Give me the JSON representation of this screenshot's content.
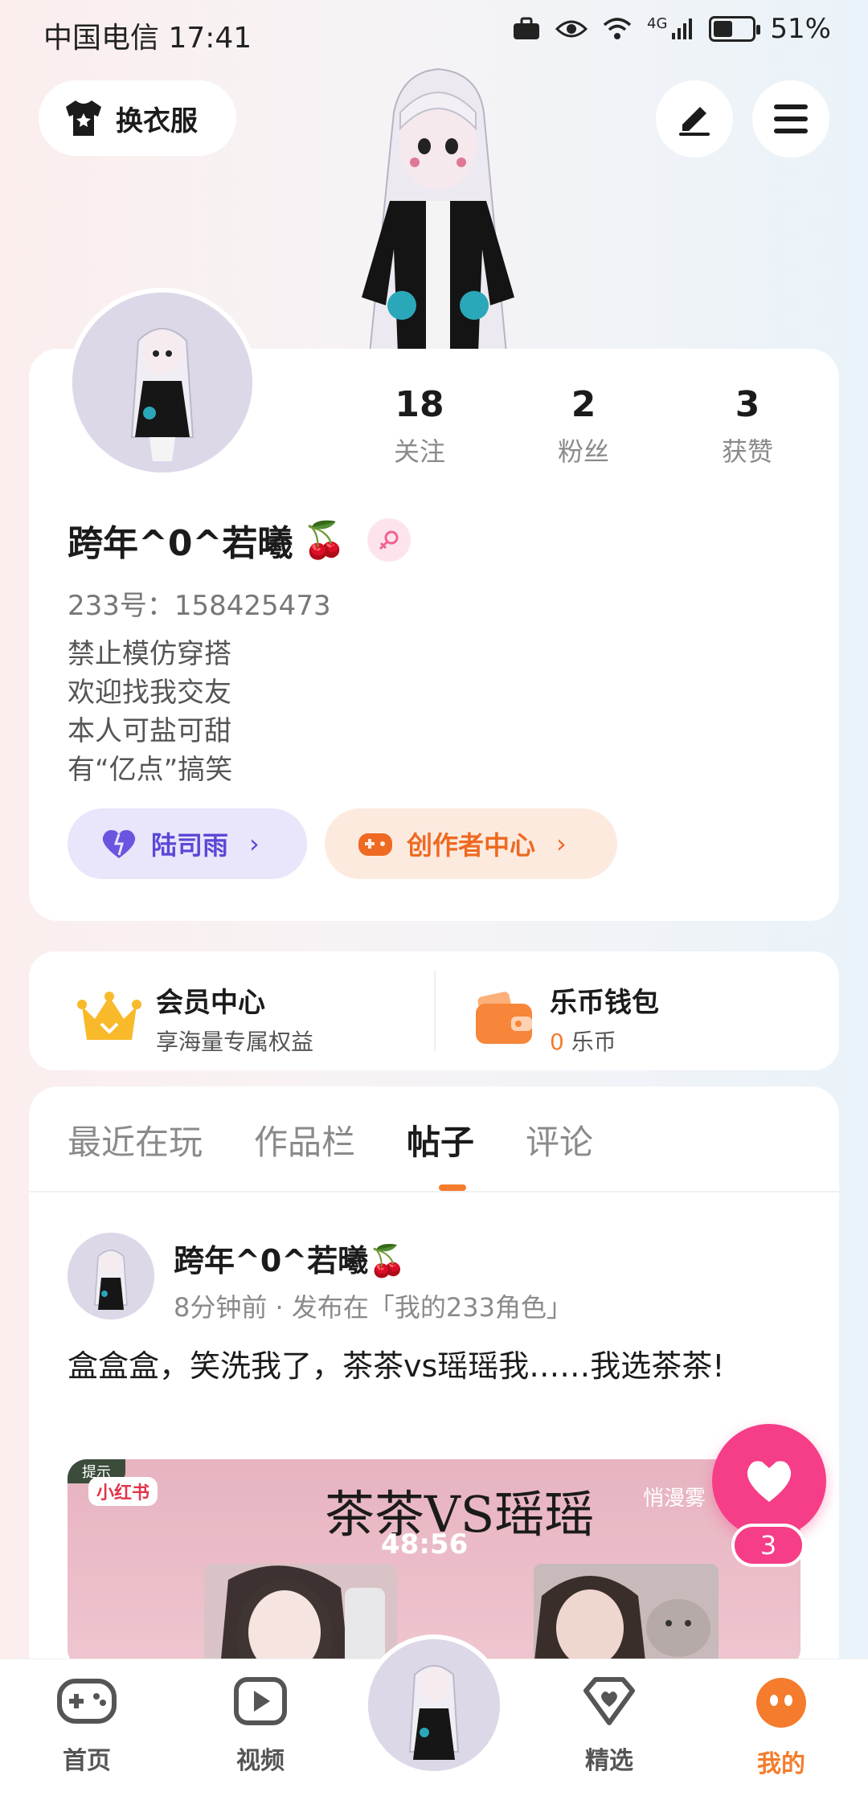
{
  "status": {
    "carrier_time": "中国电信 17:41",
    "network": "4G",
    "battery": "51%",
    "battery_level": 0.51
  },
  "header": {
    "outfit_label": "换衣服",
    "icons": [
      "shirt-icon",
      "edit-icon",
      "menu-icon"
    ]
  },
  "profile": {
    "name": "跨年^0^若曦",
    "name_emoji": "🍒",
    "uid": "233号：158425473",
    "stats": [
      {
        "num": "18",
        "label": "关注"
      },
      {
        "num": "2",
        "label": "粉丝"
      },
      {
        "num": "3",
        "label": "获赞"
      }
    ],
    "bio": [
      "禁止模仿穿搭",
      "欢迎找我交友",
      "本人可盐可甜",
      "有“亿点”搞笑"
    ],
    "partner_label": "陆司雨",
    "creator_label": "创作者中心"
  },
  "member": {
    "vip_title": "会员中心",
    "vip_sub": "享海量专属权益",
    "wallet_title": "乐币钱包",
    "wallet_amount": "0",
    "wallet_unit": "乐币"
  },
  "tabs": [
    "最近在玩",
    "作品栏",
    "帖子",
    "评论"
  ],
  "active_tab": "帖子",
  "post": {
    "author": "跨年^0^若曦",
    "author_emoji": "🍒",
    "meta": "8分钟前 · 发布在「我的233角色」",
    "text": "盒盒盒，笑洗我了，茶茶vs瑶瑶我……我选茶茶!",
    "image_title": "茶茶VS瑶瑶",
    "image_tag": "小红书",
    "image_hint": "提示",
    "image_right": "悄漫雾",
    "image_time": "48:56"
  },
  "like": {
    "count": "3"
  },
  "nav": [
    {
      "label": "首页",
      "icon": "gamepad-icon"
    },
    {
      "label": "视频",
      "icon": "play-icon"
    },
    {
      "label": "精选",
      "icon": "heart-box-icon"
    },
    {
      "label": "我的",
      "icon": "me-icon"
    }
  ],
  "colors": {
    "accent_orange": "#f47c2c",
    "like_pink": "#f63d87",
    "purple_pill": "#5a48d6"
  }
}
